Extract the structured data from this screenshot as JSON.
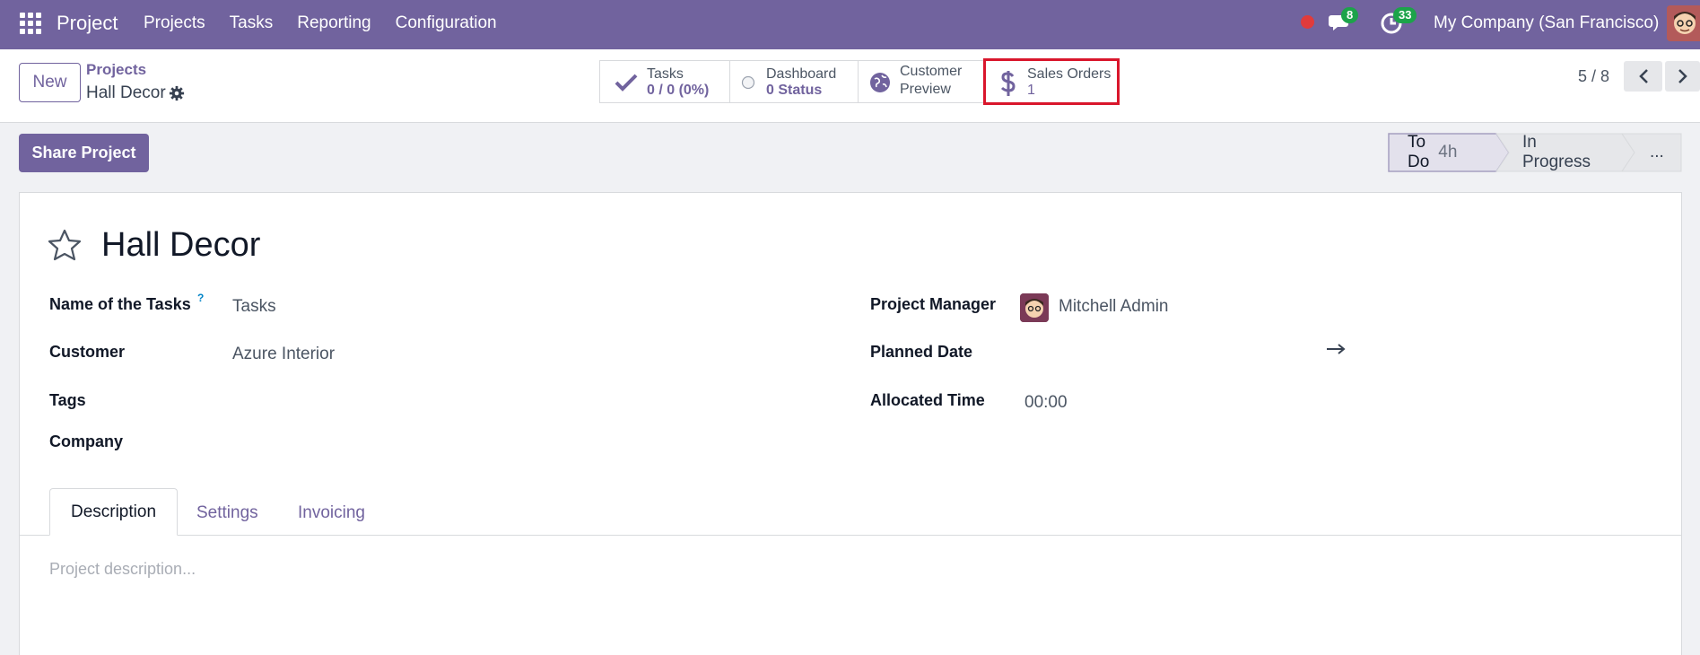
{
  "navbar": {
    "app_name": "Project",
    "menu": [
      "Projects",
      "Tasks",
      "Reporting",
      "Configuration"
    ],
    "messages_badge": "8",
    "activities_badge": "33",
    "company": "My Company (San Francisco)",
    "bg_color": "#71639e"
  },
  "control": {
    "new_label": "New",
    "breadcrumb_parent": "Projects",
    "breadcrumb_current": "Hall Decor",
    "stats": {
      "tasks_label": "Tasks",
      "tasks_value": "0 / 0 (0%)",
      "dashboard_label": "Dashboard",
      "dashboard_value": "0 Status",
      "preview_label_1": "Customer",
      "preview_label_2": "Preview",
      "sales_label": "Sales Orders",
      "sales_value": "1"
    },
    "pager": "5 / 8"
  },
  "actions": {
    "share_label": "Share Project"
  },
  "stages": {
    "todo_label": "To Do",
    "todo_time": "4h",
    "inprogress_label": "In Progress",
    "more_label": "..."
  },
  "form": {
    "title": "Hall Decor",
    "fields": {
      "tasks_name_label": "Name of the Tasks",
      "tasks_name_help": "?",
      "tasks_name_value": "Tasks",
      "customer_label": "Customer",
      "customer_value": "Azure Interior",
      "tags_label": "Tags",
      "company_label": "Company",
      "manager_label": "Project Manager",
      "manager_value": "Mitchell Admin",
      "planned_label": "Planned Date",
      "allocated_label": "Allocated Time",
      "allocated_value": "00:00"
    },
    "tabs": [
      "Description",
      "Settings",
      "Invoicing"
    ],
    "description_placeholder": "Project description..."
  },
  "colors": {
    "accent": "#71639e",
    "highlight": "#d9162c",
    "badge_green": "#1ca34a"
  },
  "icons": [
    "apps-grid-icon",
    "record-dot-icon",
    "chat-icon",
    "activity-clock-icon",
    "gear-icon",
    "check-icon",
    "status-circle-icon",
    "globe-icon",
    "dollar-icon",
    "chevron-left-icon",
    "chevron-right-icon",
    "star-icon",
    "arrow-right-icon"
  ]
}
